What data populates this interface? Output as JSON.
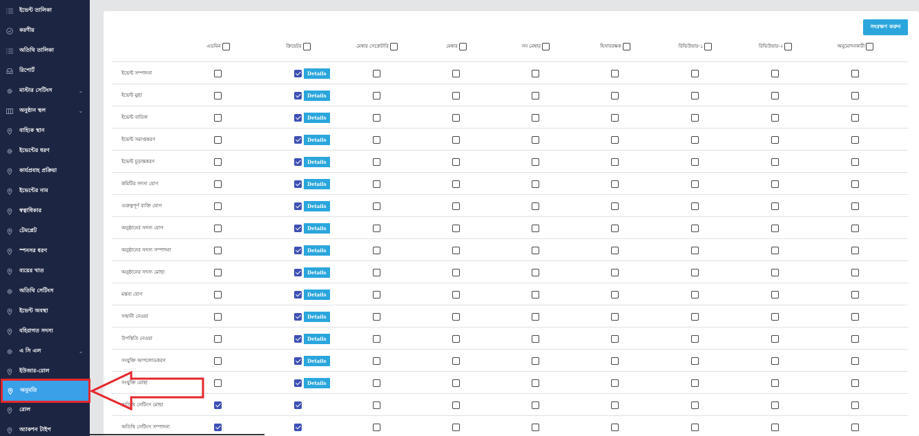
{
  "sidebar": {
    "items": [
      {
        "label": "ইভেন্ট তালিকা",
        "icon": "list-icon",
        "caret": false,
        "active": false
      },
      {
        "label": "করণীয়",
        "icon": "check-circle-icon",
        "caret": false,
        "active": false
      },
      {
        "label": "অতিথি তালিকা",
        "icon": "list-icon",
        "caret": false,
        "active": false
      },
      {
        "label": "রিপোর্ট",
        "icon": "inbox-icon",
        "caret": false,
        "active": false
      },
      {
        "label": "মাস্টার সেটিংস",
        "icon": "gear-icon",
        "caret": true,
        "active": false
      },
      {
        "label": "অনুষ্ঠান স্থল",
        "icon": "columns-icon",
        "caret": true,
        "active": false
      },
      {
        "label": "বাহ্যিক স্থান",
        "icon": "location-pin-icon",
        "caret": false,
        "active": false
      },
      {
        "label": "ইভেন্টের ধরণ",
        "icon": "gear-icon",
        "caret": false,
        "active": false
      },
      {
        "label": "কার্যপ্রবাহ প্রক্রিয়া",
        "icon": "location-pin-icon",
        "caret": false,
        "active": false
      },
      {
        "label": "ইভেন্টের নাম",
        "icon": "location-pin-icon",
        "caret": false,
        "active": false
      },
      {
        "label": "স্বত্বাধিকার",
        "icon": "location-pin-icon",
        "caret": false,
        "active": false
      },
      {
        "label": "টেমপ্লেট",
        "icon": "location-pin-icon",
        "caret": false,
        "active": false
      },
      {
        "label": "স্পনসর ধরণ",
        "icon": "location-pin-icon",
        "caret": false,
        "active": false
      },
      {
        "label": "ব্যয়ের খাত",
        "icon": "location-pin-icon",
        "caret": false,
        "active": false
      },
      {
        "label": "অতিথি সেটিংস",
        "icon": "gear-icon",
        "caret": false,
        "active": false
      },
      {
        "label": "ইভেন্ট অবস্থা",
        "icon": "location-pin-icon",
        "caret": false,
        "active": false
      },
      {
        "label": "বহিরাগত সদস্য",
        "icon": "location-pin-icon",
        "caret": false,
        "active": false
      },
      {
        "label": "এ সি এল",
        "icon": "gear-icon",
        "caret": true,
        "active": false
      },
      {
        "label": "ইউজার-রোল",
        "icon": "location-pin-icon",
        "caret": false,
        "active": false
      },
      {
        "label": "অনুমতি",
        "icon": "location-pin-icon",
        "caret": false,
        "active": true
      },
      {
        "label": "রোল",
        "icon": "location-pin-icon",
        "caret": false,
        "active": false
      },
      {
        "label": "অ্যাকশন টাইপ",
        "icon": "location-pin-icon",
        "caret": false,
        "active": false
      }
    ]
  },
  "toolbar": {
    "save_label": "সংরক্ষণ করুন"
  },
  "columns": [
    {
      "label": "এডমিন",
      "checked": false
    },
    {
      "label": "ক্রিয়েটর",
      "checked": false
    },
    {
      "label": "মেম্বার সেক্রেটারি",
      "checked": false
    },
    {
      "label": "মেম্বার",
      "checked": false
    },
    {
      "label": "নন মেম্বার",
      "checked": false
    },
    {
      "label": "হিসাবরক্ষক",
      "checked": false
    },
    {
      "label": "রিভিউয়ার-১",
      "checked": false
    },
    {
      "label": "রিভিউয়ার-২",
      "checked": false
    },
    {
      "label": "অনুমোদনকারী",
      "checked": false
    }
  ],
  "details_label": "Details",
  "rows": [
    {
      "label": "ইভেন্ট সম্পাদনা",
      "checks": [
        false,
        true,
        false,
        false,
        false,
        false,
        false,
        false,
        false
      ],
      "details": true
    },
    {
      "label": "ইভেন্ট মুছা",
      "checks": [
        false,
        true,
        false,
        false,
        false,
        false,
        false,
        false,
        false
      ],
      "details": true
    },
    {
      "label": "ইভেন্ট বাতিল",
      "checks": [
        false,
        true,
        false,
        false,
        false,
        false,
        false,
        false,
        false
      ],
      "details": true
    },
    {
      "label": "ইভেন্ট সমাপ্তকরণ",
      "checks": [
        false,
        true,
        false,
        false,
        false,
        false,
        false,
        false,
        false
      ],
      "details": true
    },
    {
      "label": "ইভেন্ট চূড়ান্তকরণ",
      "checks": [
        false,
        true,
        false,
        false,
        false,
        false,
        false,
        false,
        false
      ],
      "details": true
    },
    {
      "label": "কমিটির সদস্য যোগ",
      "checks": [
        false,
        true,
        false,
        false,
        false,
        false,
        false,
        false,
        false
      ],
      "details": true
    },
    {
      "label": "গুরুত্বপূর্ণ ব্যক্তি যোগ",
      "checks": [
        false,
        true,
        false,
        false,
        false,
        false,
        false,
        false,
        false
      ],
      "details": true
    },
    {
      "label": "অনুষ্ঠানের সদস্য যোগ",
      "checks": [
        false,
        true,
        false,
        false,
        false,
        false,
        false,
        false,
        false
      ],
      "details": true
    },
    {
      "label": "অনুষ্ঠানের সদস্য সম্পাদনা",
      "checks": [
        false,
        true,
        false,
        false,
        false,
        false,
        false,
        false,
        false
      ],
      "details": true
    },
    {
      "label": "অনুষ্ঠানের সদস্য মোছা",
      "checks": [
        false,
        true,
        false,
        false,
        false,
        false,
        false,
        false,
        false
      ],
      "details": true
    },
    {
      "label": "মন্তব্য যোগ",
      "checks": [
        false,
        true,
        false,
        false,
        false,
        false,
        false,
        false,
        false
      ],
      "details": true
    },
    {
      "label": "সম্মানী নেওয়া",
      "checks": [
        false,
        true,
        false,
        false,
        false,
        false,
        false,
        false,
        false
      ],
      "details": true
    },
    {
      "label": "উপস্থিতি নেওয়া",
      "checks": [
        false,
        true,
        false,
        false,
        false,
        false,
        false,
        false,
        false
      ],
      "details": true
    },
    {
      "label": "সংযুক্তি আপলোডকরণ",
      "checks": [
        false,
        true,
        false,
        false,
        false,
        false,
        false,
        false,
        false
      ],
      "details": true
    },
    {
      "label": "সংযুক্তি মোছা",
      "checks": [
        false,
        true,
        false,
        false,
        false,
        false,
        false,
        false,
        false
      ],
      "details": true
    },
    {
      "label": "অতিথি সেটিংস মোছা",
      "checks": [
        true,
        true,
        false,
        false,
        false,
        false,
        false,
        false,
        false
      ],
      "details": false
    },
    {
      "label": "অতিথি সেটিংস সম্পাদনা",
      "checks": [
        true,
        true,
        false,
        false,
        false,
        false,
        false,
        false,
        false
      ],
      "details": false
    }
  ],
  "colors": {
    "sidebar_bg": "#1c2541",
    "active_item": "#3aa0e8",
    "button": "#2aa6dd",
    "checked": "#3f51b5",
    "annotation": "#e6272c"
  }
}
